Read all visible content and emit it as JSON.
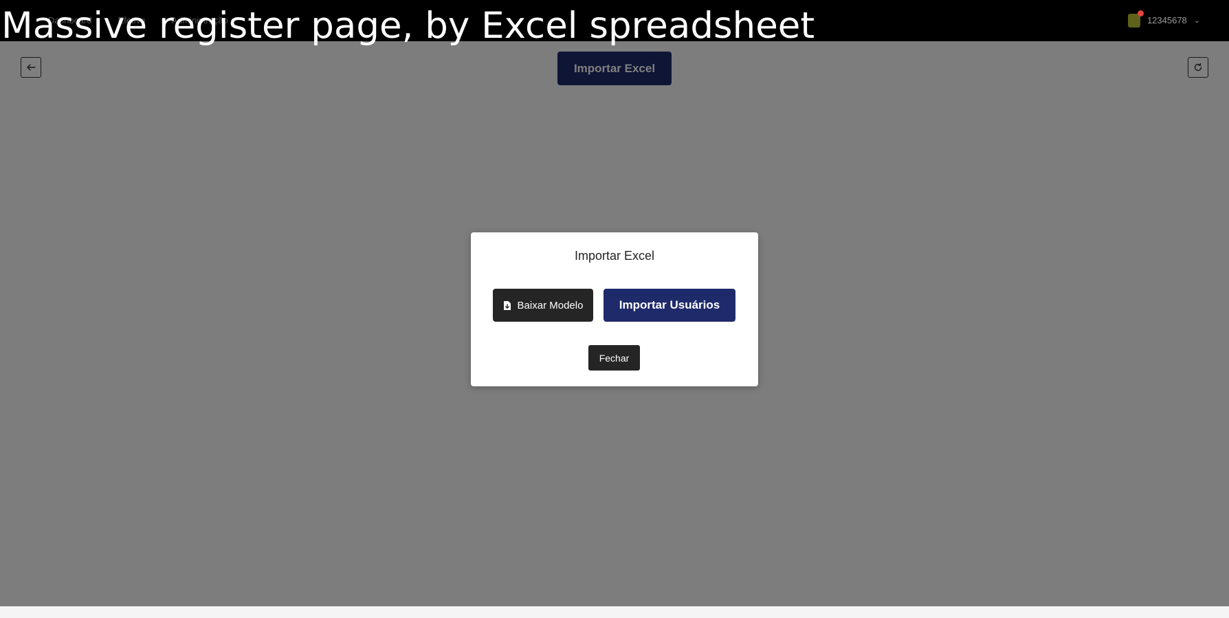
{
  "caption": "Massive register page, by Excel spreadsheet",
  "nav": {
    "items": [
      {
        "label": "Dashboard"
      },
      {
        "label": "Efetivo"
      },
      {
        "label": "Administração"
      }
    ]
  },
  "user": {
    "id": "12345678",
    "avatar_icon": "user-badge-icon",
    "has_notification": true
  },
  "page": {
    "back_icon": "arrow-left-icon",
    "refresh_icon": "refresh-icon",
    "import_button_label": "Importar Excel"
  },
  "modal": {
    "title": "Importar Excel",
    "download_label": "Baixar Modelo",
    "download_icon": "file-download-icon",
    "import_users_label": "Importar Usuários",
    "close_label": "Fechar"
  },
  "colors": {
    "primary": "#1f2a6b",
    "dark": "#252525",
    "overlay": "rgba(0,0,0,0.5)"
  }
}
